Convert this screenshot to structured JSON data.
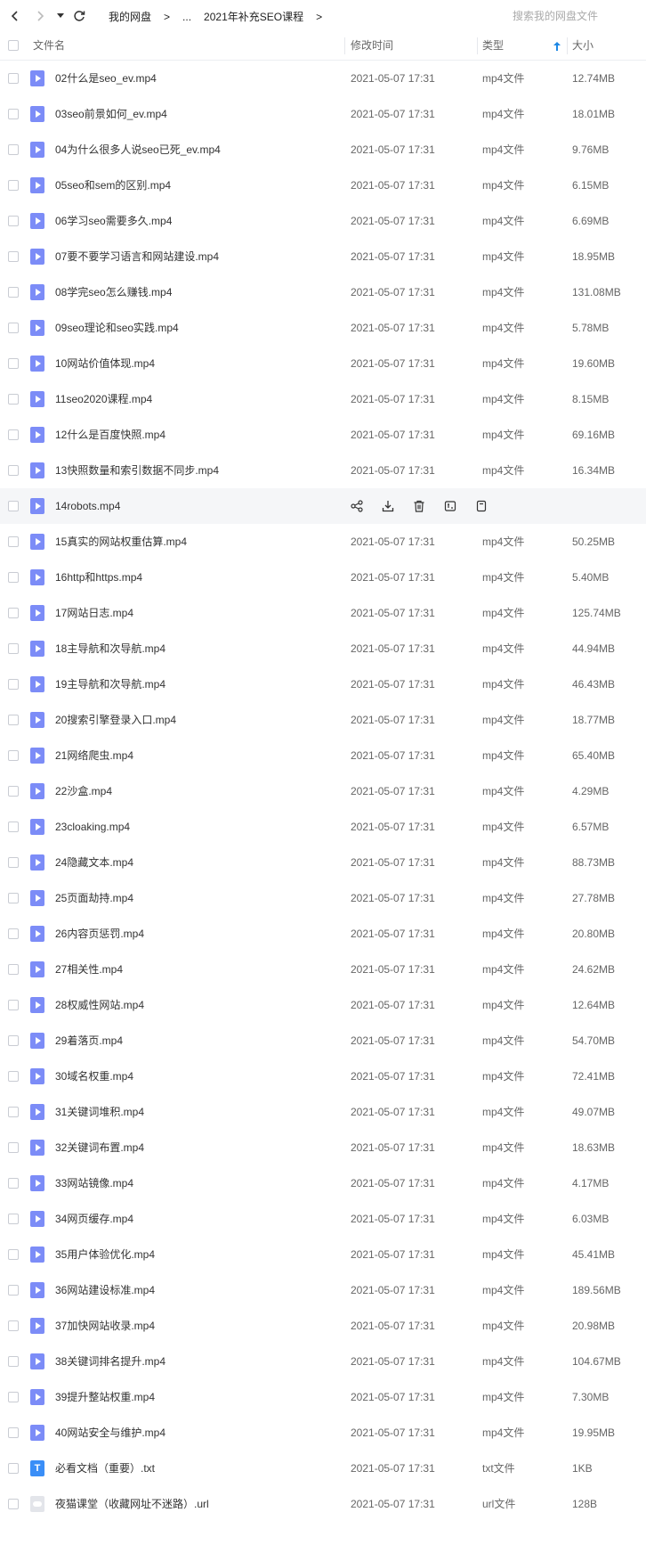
{
  "breadcrumb": {
    "root": "我的网盘",
    "separator": ">",
    "ellipsis": "...",
    "current": "2021年补充SEO课程"
  },
  "search": {
    "placeholder": "搜索我的网盘文件"
  },
  "columns": {
    "name": "文件名",
    "modified": "修改时间",
    "type": "类型",
    "size": "大小"
  },
  "colors": {
    "accent": "#1e88e5",
    "video_icon": "#7c8cf7",
    "txt_icon": "#3a8ef7",
    "hover_row": "#f5f6f8"
  },
  "files": [
    {
      "name": "02什么是seo_ev.mp4",
      "date": "2021-05-07 17:31",
      "type": "mp4文件",
      "size": "12.74MB",
      "icon": "video"
    },
    {
      "name": "03seo前景如何_ev.mp4",
      "date": "2021-05-07 17:31",
      "type": "mp4文件",
      "size": "18.01MB",
      "icon": "video"
    },
    {
      "name": "04为什么很多人说seo已死_ev.mp4",
      "date": "2021-05-07 17:31",
      "type": "mp4文件",
      "size": "9.76MB",
      "icon": "video"
    },
    {
      "name": "05seo和sem的区别.mp4",
      "date": "2021-05-07 17:31",
      "type": "mp4文件",
      "size": "6.15MB",
      "icon": "video"
    },
    {
      "name": "06学习seo需要多久.mp4",
      "date": "2021-05-07 17:31",
      "type": "mp4文件",
      "size": "6.69MB",
      "icon": "video"
    },
    {
      "name": "07要不要学习语言和网站建设.mp4",
      "date": "2021-05-07 17:31",
      "type": "mp4文件",
      "size": "18.95MB",
      "icon": "video"
    },
    {
      "name": "08学完seo怎么赚钱.mp4",
      "date": "2021-05-07 17:31",
      "type": "mp4文件",
      "size": "131.08MB",
      "icon": "video"
    },
    {
      "name": "09seo理论和seo实践.mp4",
      "date": "2021-05-07 17:31",
      "type": "mp4文件",
      "size": "5.78MB",
      "icon": "video"
    },
    {
      "name": "10网站价值体现.mp4",
      "date": "2021-05-07 17:31",
      "type": "mp4文件",
      "size": "19.60MB",
      "icon": "video"
    },
    {
      "name": "11seo2020课程.mp4",
      "date": "2021-05-07 17:31",
      "type": "mp4文件",
      "size": "8.15MB",
      "icon": "video"
    },
    {
      "name": "12什么是百度快照.mp4",
      "date": "2021-05-07 17:31",
      "type": "mp4文件",
      "size": "69.16MB",
      "icon": "video"
    },
    {
      "name": "13快照数量和索引数据不同步.mp4",
      "date": "2021-05-07 17:31",
      "type": "mp4文件",
      "size": "16.34MB",
      "icon": "video"
    },
    {
      "name": "14robots.mp4",
      "date": "",
      "type": "",
      "size": "",
      "icon": "video",
      "hover": true
    },
    {
      "name": "15真实的网站权重估算.mp4",
      "date": "2021-05-07 17:31",
      "type": "mp4文件",
      "size": "50.25MB",
      "icon": "video"
    },
    {
      "name": "16http和https.mp4",
      "date": "2021-05-07 17:31",
      "type": "mp4文件",
      "size": "5.40MB",
      "icon": "video"
    },
    {
      "name": "17网站日志.mp4",
      "date": "2021-05-07 17:31",
      "type": "mp4文件",
      "size": "125.74MB",
      "icon": "video"
    },
    {
      "name": "18主导航和次导航.mp4",
      "date": "2021-05-07 17:31",
      "type": "mp4文件",
      "size": "44.94MB",
      "icon": "video"
    },
    {
      "name": "19主导航和次导航.mp4",
      "date": "2021-05-07 17:31",
      "type": "mp4文件",
      "size": "46.43MB",
      "icon": "video"
    },
    {
      "name": "20搜索引擎登录入口.mp4",
      "date": "2021-05-07 17:31",
      "type": "mp4文件",
      "size": "18.77MB",
      "icon": "video"
    },
    {
      "name": "21网络爬虫.mp4",
      "date": "2021-05-07 17:31",
      "type": "mp4文件",
      "size": "65.40MB",
      "icon": "video"
    },
    {
      "name": "22沙盒.mp4",
      "date": "2021-05-07 17:31",
      "type": "mp4文件",
      "size": "4.29MB",
      "icon": "video"
    },
    {
      "name": "23cloaking.mp4",
      "date": "2021-05-07 17:31",
      "type": "mp4文件",
      "size": "6.57MB",
      "icon": "video"
    },
    {
      "name": "24隐藏文本.mp4",
      "date": "2021-05-07 17:31",
      "type": "mp4文件",
      "size": "88.73MB",
      "icon": "video"
    },
    {
      "name": "25页面劫持.mp4",
      "date": "2021-05-07 17:31",
      "type": "mp4文件",
      "size": "27.78MB",
      "icon": "video"
    },
    {
      "name": "26内容页惩罚.mp4",
      "date": "2021-05-07 17:31",
      "type": "mp4文件",
      "size": "20.80MB",
      "icon": "video"
    },
    {
      "name": "27相关性.mp4",
      "date": "2021-05-07 17:31",
      "type": "mp4文件",
      "size": "24.62MB",
      "icon": "video"
    },
    {
      "name": "28权威性网站.mp4",
      "date": "2021-05-07 17:31",
      "type": "mp4文件",
      "size": "12.64MB",
      "icon": "video"
    },
    {
      "name": "29着落页.mp4",
      "date": "2021-05-07 17:31",
      "type": "mp4文件",
      "size": "54.70MB",
      "icon": "video"
    },
    {
      "name": "30域名权重.mp4",
      "date": "2021-05-07 17:31",
      "type": "mp4文件",
      "size": "72.41MB",
      "icon": "video"
    },
    {
      "name": "31关键词堆积.mp4",
      "date": "2021-05-07 17:31",
      "type": "mp4文件",
      "size": "49.07MB",
      "icon": "video"
    },
    {
      "name": "32关键词布置.mp4",
      "date": "2021-05-07 17:31",
      "type": "mp4文件",
      "size": "18.63MB",
      "icon": "video"
    },
    {
      "name": "33网站镜像.mp4",
      "date": "2021-05-07 17:31",
      "type": "mp4文件",
      "size": "4.17MB",
      "icon": "video"
    },
    {
      "name": "34网页缓存.mp4",
      "date": "2021-05-07 17:31",
      "type": "mp4文件",
      "size": "6.03MB",
      "icon": "video"
    },
    {
      "name": "35用户体验优化.mp4",
      "date": "2021-05-07 17:31",
      "type": "mp4文件",
      "size": "45.41MB",
      "icon": "video"
    },
    {
      "name": "36网站建设标准.mp4",
      "date": "2021-05-07 17:31",
      "type": "mp4文件",
      "size": "189.56MB",
      "icon": "video"
    },
    {
      "name": "37加快网站收录.mp4",
      "date": "2021-05-07 17:31",
      "type": "mp4文件",
      "size": "20.98MB",
      "icon": "video"
    },
    {
      "name": "38关键词排名提升.mp4",
      "date": "2021-05-07 17:31",
      "type": "mp4文件",
      "size": "104.67MB",
      "icon": "video"
    },
    {
      "name": "39提升整站权重.mp4",
      "date": "2021-05-07 17:31",
      "type": "mp4文件",
      "size": "7.30MB",
      "icon": "video"
    },
    {
      "name": "40网站安全与维护.mp4",
      "date": "2021-05-07 17:31",
      "type": "mp4文件",
      "size": "19.95MB",
      "icon": "video"
    },
    {
      "name": "必看文档（重要）.txt",
      "date": "2021-05-07 17:31",
      "type": "txt文件",
      "size": "1KB",
      "icon": "txt",
      "icon_label": "T"
    },
    {
      "name": "夜猫课堂（收藏网址不迷路）.url",
      "date": "2021-05-07 17:31",
      "type": "url文件",
      "size": "128B",
      "icon": "url"
    }
  ],
  "row_actions": [
    "share-icon",
    "download-icon",
    "delete-icon",
    "rename-icon",
    "more-icon"
  ]
}
